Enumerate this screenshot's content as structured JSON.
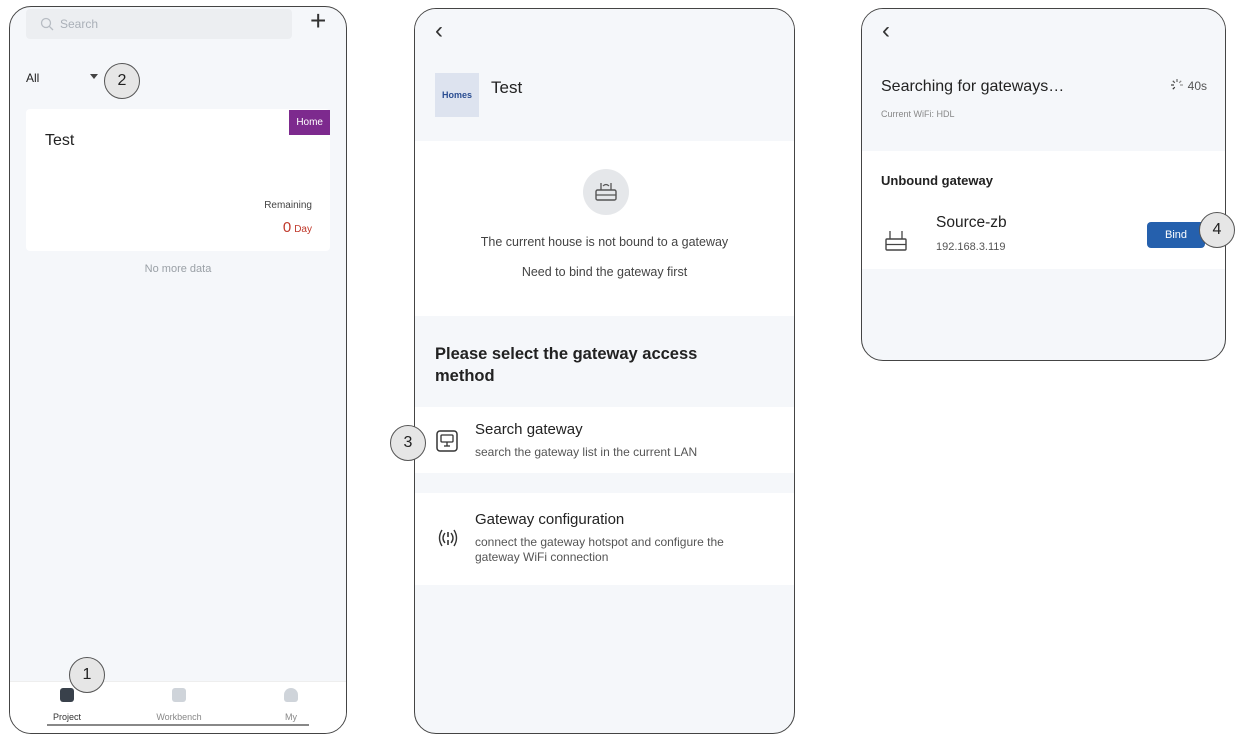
{
  "screen1": {
    "search_placeholder": "Search",
    "add_icon": "plus-icon",
    "filter_value": "All",
    "project": {
      "title": "Test",
      "badge": "Home",
      "remaining_label": "Remaining",
      "remaining_value": "0",
      "remaining_unit": "Day"
    },
    "no_more": "No more data",
    "tabs": [
      {
        "label": "Project",
        "icon": "project-icon",
        "active": true
      },
      {
        "label": "Workbench",
        "icon": "workbench-icon",
        "active": false
      },
      {
        "label": "My",
        "icon": "user-icon",
        "active": false
      }
    ]
  },
  "screen2": {
    "back_icon": "back-arrow-icon",
    "home_logo": "Homes",
    "home_name": "Test",
    "empty_msg1": "The current house is not bound to a gateway",
    "empty_msg2": "Need to bind the gateway first",
    "section_title": "Please select the gateway access method",
    "options": [
      {
        "title": "Search gateway",
        "desc": "search the gateway list in the current LAN",
        "icon": "router-search-icon"
      },
      {
        "title": "Gateway configuration",
        "desc": "connect the gateway hotspot and configure the gateway WiFi connection",
        "icon": "wifi-broadcast-icon"
      }
    ]
  },
  "screen3": {
    "back_icon": "back-arrow-icon",
    "title": "Searching for gateways…",
    "timer": "40s",
    "current_wifi": "Current WiFi:  HDL",
    "section": "Unbound gateway",
    "gateway_name": "Source-zb",
    "gateway_ip": "192.168.3.119",
    "bind_label": "Bind"
  },
  "callouts": [
    "1",
    "2",
    "3",
    "4"
  ],
  "colors": {
    "badge": "#7d2a8e",
    "remaining": "#c0392b",
    "bind": "#2560ad"
  }
}
